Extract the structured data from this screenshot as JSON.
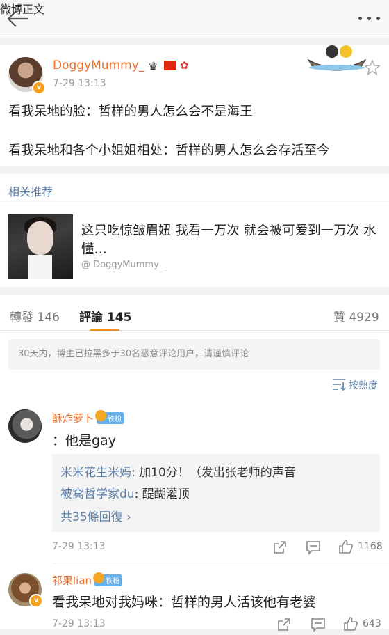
{
  "header": {
    "title": "微博正文"
  },
  "post": {
    "author": "DoggyMummy_",
    "verified_mark": "v",
    "time": "7-29 13:13",
    "lines": [
      "看我呆地的脸：哲样的男人怎么会不是海王",
      "看我呆地和各个小姐姐相处：哲样的男人怎么会存活至今"
    ]
  },
  "related": {
    "heading": "相关推荐",
    "title": "这只吃惊皱眉妞 我看一万次 就会被可爱到一万次 水懂…",
    "source": "@ DoggyMummy_"
  },
  "tabs": {
    "repost_label": "轉發",
    "repost_count": "146",
    "comment_label": "評論",
    "comment_count": "145",
    "like_label": "贊",
    "like_count": "4929"
  },
  "notice": "30天内，博主已拉黑多于30名恶意评论用户，请谨慎评论",
  "sort_label": "按熱度",
  "comments": [
    {
      "name": "酥炸萝卜",
      "badge": "铁粉",
      "text": "：他是gay",
      "replies": [
        {
          "name": "米米花生米妈",
          "text": ": 加10分！（发出张老师的声音"
        },
        {
          "name": "被窝哲学家du",
          "text": ": 醍醐灌顶"
        }
      ],
      "more_replies": "共35條回復 ›",
      "time": "7-29 13:13",
      "likes": "1168"
    },
    {
      "name": "祁果lian",
      "badge": "铁粉",
      "text": "看我呆地对我妈咪：哲样的男人活该他有老婆",
      "time": "7-29 13:13",
      "likes": "643"
    }
  ],
  "icons": [
    "back-arrow-icon",
    "more-icon",
    "star-icon",
    "sort-icon",
    "share-icon",
    "comment-icon",
    "like-icon"
  ],
  "colors": {
    "accent": "#f68b1f",
    "name": "#f26d22",
    "link": "#5c7fa8"
  }
}
